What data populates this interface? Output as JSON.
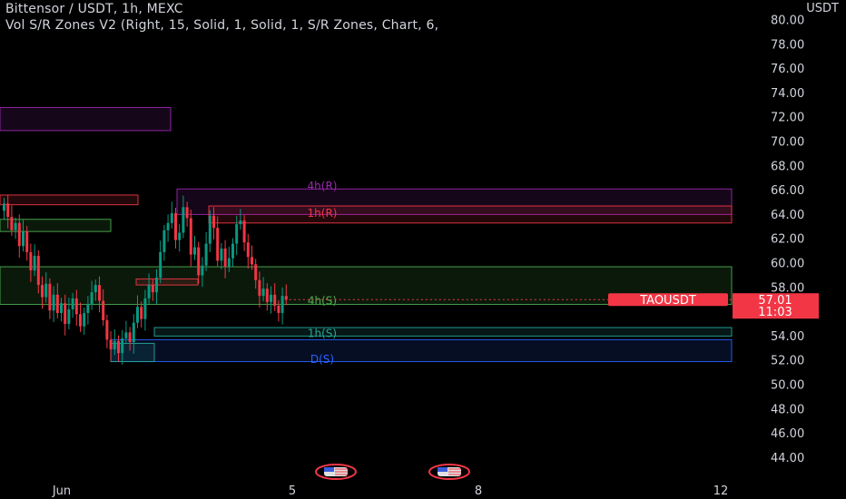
{
  "symbol_title": "Bittensor / USDT, 1h, MEXC",
  "indicator": "Vol S/R Zones V2 (Right, 15, Solid, 1, Solid, 1, S/R Zones, Chart, 6,",
  "currency": "USDT",
  "price_tag": {
    "symbol": "TAOUSDT",
    "price": "57.01",
    "countdown": "11:03",
    "color": "#f23645"
  },
  "colors": {
    "background": "#000000",
    "up_candle": "#089981",
    "down_candle": "#f23645",
    "resistance_4h": "#9c27b0",
    "resistance_1h": "#f23645",
    "support_4h": "#4caf50",
    "support_1h": "#26a69a",
    "support_d": "#2962ff",
    "axis_text": "#d1d4dc"
  },
  "chart_data": {
    "type": "candlestick",
    "ylim": [
      42.5,
      81
    ],
    "y_ticks": [
      "80.00",
      "78.00",
      "76.00",
      "74.00",
      "72.00",
      "70.00",
      "68.00",
      "66.00",
      "64.00",
      "62.00",
      "60.00",
      "58.00",
      "56.00",
      "54.00",
      "52.00",
      "50.00",
      "48.00",
      "46.00",
      "44.00"
    ],
    "x_ticks": [
      "Jun",
      "5",
      "8",
      "12"
    ],
    "zone_labels": [
      {
        "text": "4h(R)",
        "color": "#9c27b0",
        "y": 66.35
      },
      {
        "text": "1h(R)",
        "color": "#f23645",
        "y": 64.1
      },
      {
        "text": "4h(S)",
        "color": "#4caf50",
        "y": 56.9
      },
      {
        "text": "1h(S)",
        "color": "#26a69a",
        "y": 54.2
      },
      {
        "text": "D(S)",
        "color": "#2962ff",
        "y": 52.1
      }
    ],
    "closes": [
      64.9,
      63.8,
      62.7,
      63.3,
      61.4,
      62.6,
      60.9,
      59.4,
      60.6,
      58.2,
      57.2,
      58.3,
      56.1,
      57.4,
      55.9,
      56.7,
      55.0,
      56.2,
      57.1,
      55.8,
      54.8,
      55.9,
      56.6,
      57.6,
      58.2,
      56.9,
      55.3,
      53.7,
      52.9,
      53.6,
      52.6,
      53.8,
      54.3,
      53.5,
      55.1,
      56.4,
      55.4,
      57.1,
      58.2,
      57.6,
      58.8,
      60.9,
      62.7,
      63.3,
      64.1,
      61.9,
      62.5,
      64.6,
      63.7,
      60.7,
      61.3,
      59.0,
      59.8,
      61.6,
      63.9,
      62.9,
      60.2,
      61.2,
      59.7,
      60.4,
      61.6,
      63.2,
      63.5,
      61.7,
      60.5,
      59.9,
      58.6,
      57.3,
      57.9,
      56.8,
      57.4,
      56.5,
      55.9,
      57.3,
      57.0
    ]
  }
}
